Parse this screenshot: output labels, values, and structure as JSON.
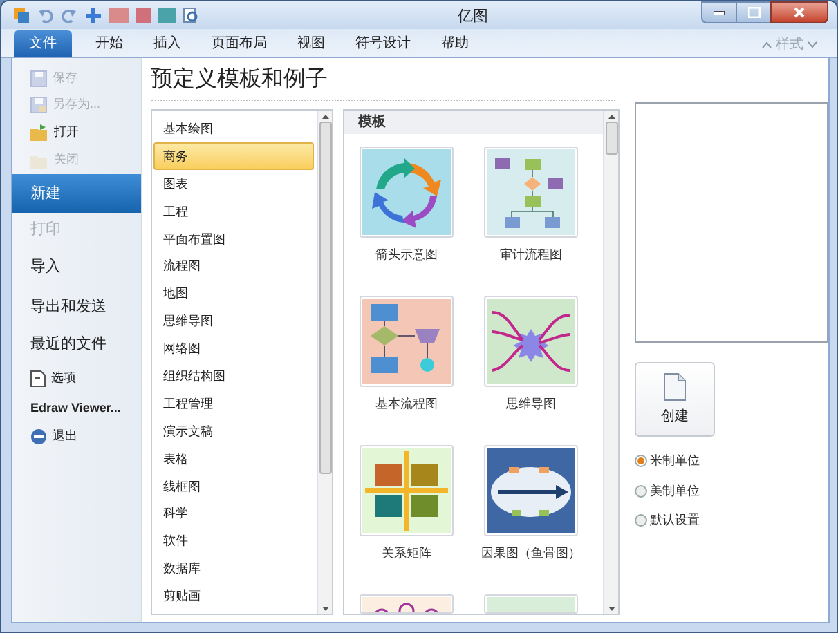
{
  "window": {
    "title": "亿图"
  },
  "ribbon_tabs": [
    {
      "label": "文件",
      "selected": true
    },
    {
      "label": "开始",
      "selected": false
    },
    {
      "label": "插入",
      "selected": false
    },
    {
      "label": "页面布局",
      "selected": false
    },
    {
      "label": "视图",
      "selected": false
    },
    {
      "label": "符号设计",
      "selected": false
    },
    {
      "label": "帮助",
      "selected": false
    }
  ],
  "style_menu": {
    "label": "样式"
  },
  "file_menu": [
    {
      "label": "保存",
      "kind": "small",
      "disabled": true,
      "selected": false
    },
    {
      "label": "另存为...",
      "kind": "small",
      "disabled": true,
      "selected": false
    },
    {
      "label": "打开",
      "kind": "small",
      "disabled": false,
      "selected": false
    },
    {
      "label": "关闭",
      "kind": "small",
      "disabled": true,
      "selected": false
    },
    {
      "label": "新建",
      "kind": "large",
      "disabled": false,
      "selected": true
    },
    {
      "label": "打印",
      "kind": "large",
      "disabled": true,
      "selected": false
    },
    {
      "label": "导入",
      "kind": "large",
      "disabled": false,
      "selected": false
    },
    {
      "label": "导出和发送",
      "kind": "large",
      "disabled": false,
      "selected": false
    },
    {
      "label": "最近的文件",
      "kind": "large",
      "disabled": false,
      "selected": false
    },
    {
      "label": "选项",
      "kind": "small",
      "disabled": false,
      "selected": false
    },
    {
      "label": "Edraw Viewer...",
      "kind": "small",
      "disabled": false,
      "selected": false
    },
    {
      "label": "退出",
      "kind": "small",
      "disabled": false,
      "selected": false
    }
  ],
  "heading": "预定义模板和例子",
  "categories": [
    {
      "label": "基本绘图",
      "selected": false
    },
    {
      "label": "商务",
      "selected": true
    },
    {
      "label": "图表",
      "selected": false
    },
    {
      "label": "工程",
      "selected": false
    },
    {
      "label": "平面布置图",
      "selected": false
    },
    {
      "label": "流程图",
      "selected": false
    },
    {
      "label": "地图",
      "selected": false
    },
    {
      "label": "思维导图",
      "selected": false
    },
    {
      "label": "网络图",
      "selected": false
    },
    {
      "label": "组织结构图",
      "selected": false
    },
    {
      "label": "工程管理",
      "selected": false
    },
    {
      "label": "演示文稿",
      "selected": false
    },
    {
      "label": "表格",
      "selected": false
    },
    {
      "label": "线框图",
      "selected": false
    },
    {
      "label": "科学",
      "selected": false
    },
    {
      "label": "软件",
      "selected": false
    },
    {
      "label": "数据库",
      "selected": false
    },
    {
      "label": "剪贴画",
      "selected": false
    }
  ],
  "templates_header": "模板",
  "templates": [
    {
      "kind": "full",
      "label": "箭头示意图"
    },
    {
      "kind": "full",
      "label": "审计流程图"
    },
    {
      "kind": "full",
      "label": "基本流程图"
    },
    {
      "kind": "full",
      "label": "思维导图"
    },
    {
      "kind": "full",
      "label": "关系矩阵"
    },
    {
      "kind": "full",
      "label": "因果图（鱼骨图）"
    },
    {
      "kind": "partial"
    },
    {
      "kind": "partial"
    }
  ],
  "create_button": {
    "label": "创建"
  },
  "units": [
    {
      "label": "米制单位",
      "selected": true
    },
    {
      "label": "美制单位",
      "selected": false
    },
    {
      "label": "默认设置",
      "selected": false
    }
  ]
}
